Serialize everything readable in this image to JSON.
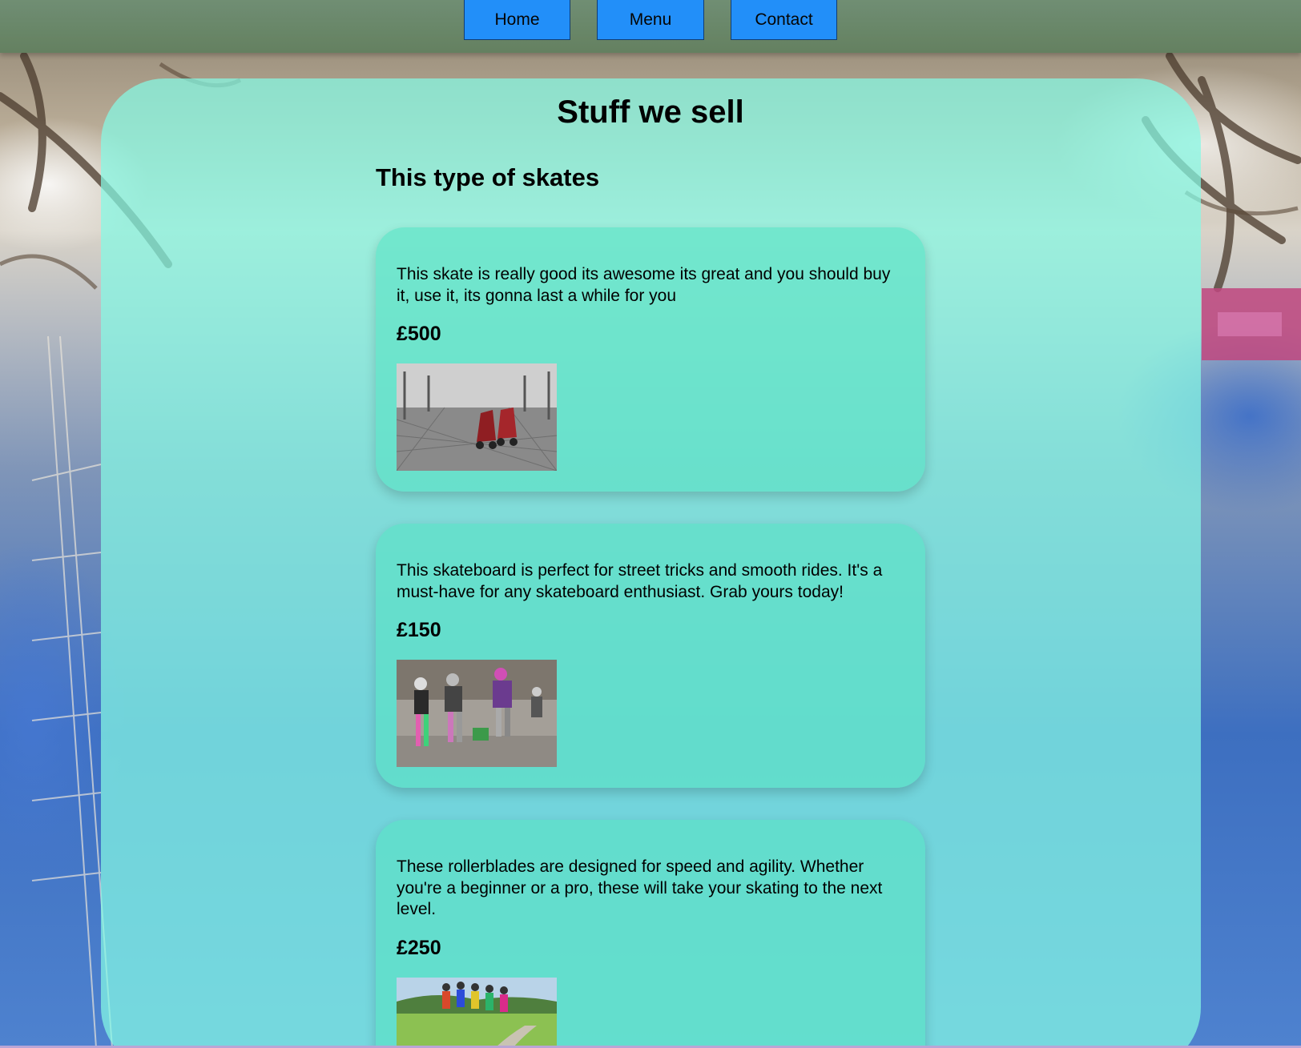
{
  "nav": {
    "home_label": "Home",
    "menu_label": "Menu",
    "contact_label": "Contact",
    "button_color": "#1e90ff"
  },
  "page": {
    "title": "Stuff we sell",
    "section_title": "This type of skates"
  },
  "products": [
    {
      "description": "This skate is really good its awesome its great and you should buy it, use it, its gonna last a while for you",
      "price": "£500",
      "image": "red-roller-skates-on-wooden-deck-photo"
    },
    {
      "description": "This skateboard is perfect for street tricks and smooth rides. It's a must-have for any skateboard enthusiast. Grab yours today!",
      "price": "£150",
      "image": "roller-derby-skaters-photo"
    },
    {
      "description": "These rollerblades are designed for speed and agility. Whether you're a beginner or a pro, these will take your skating to the next level.",
      "price": "£250",
      "image": "inline-skaters-on-country-road-photo"
    }
  ],
  "colors": {
    "panel": "#85fae4",
    "card": "#58e2c4",
    "navbar": "#6a8a68"
  }
}
